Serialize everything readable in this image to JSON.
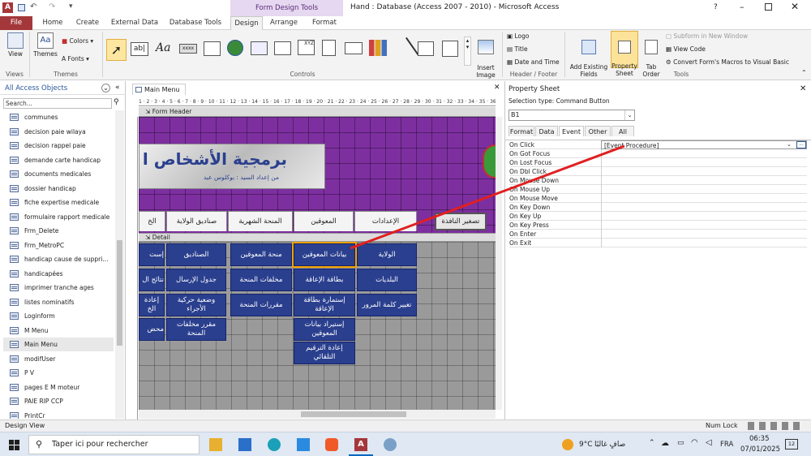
{
  "titlebar": {
    "title": "Hand : Database (Access 2007 - 2010) - Microsoft Access",
    "context_tab": "Form Design Tools"
  },
  "ribbon_tabs": [
    "File",
    "Home",
    "Create",
    "External Data",
    "Database Tools",
    "Design",
    "Arrange",
    "Format"
  ],
  "ribbon": {
    "views": {
      "view": "View",
      "group": "Views"
    },
    "themes": {
      "themes": "Themes",
      "colors": "Colors",
      "fonts": "Fonts",
      "group": "Themes"
    },
    "controls": {
      "group": "Controls",
      "insert_image": "Insert\nImage"
    },
    "header_footer": {
      "logo": "Logo",
      "title": "Title",
      "date_time": "Date and Time",
      "group": "Header / Footer"
    },
    "tools": {
      "add_fields": "Add Existing\nFields",
      "property_sheet": "Property\nSheet",
      "tab_order": "Tab\nOrder",
      "subform": "Subform in New Window",
      "view_code": "View Code",
      "convert": "Convert Form's Macros to Visual Basic",
      "group": "Tools"
    }
  },
  "nav": {
    "header": "All Access Objects",
    "search_placeholder": "Search...",
    "items": [
      "communes",
      "decision paie wilaya",
      "decision rappel paie",
      "demande carte handicap",
      "documents medicales",
      "dossier handicap",
      "fiche expertise medicale",
      "formulaire rapport medicale",
      "Frm_Delete",
      "Frm_MetroPC",
      "handicap cause de suppri...",
      "handicapées",
      "imprimer tranche ages",
      "listes nominatifs",
      "Loginform",
      "M Menu",
      "Main Menu",
      "modifUser",
      "P V",
      "pages E M moteur",
      "PAIE RIP CCP",
      "PrintCr"
    ],
    "selected": "Main Menu"
  },
  "doc": {
    "tab": "Main Menu",
    "form_header": "Form Header",
    "detail": "Detail",
    "banner_title": "برمجية الأشخاص ا",
    "banner_sub": "من إعداد السيد : بوكلوس عبد",
    "ruler": "1 · 2 · 3 · 4 · 5 · 6 · 7 · 8 · 9 · 10 · 11 · 12 · 13 · 14 · 15 · 16 · 17 · 18 · 19 · 20 · 21 · 22 · 23 · 24 · 25 · 26 · 27 · 28 · 29 · 30 · 31 · 32 · 33 · 34 · 35 · 36 · 37 · 38 · 39 · 40",
    "tabs": [
      "الإعدادات",
      "المعوقين",
      "المنحة الشهرية",
      "صناديق الولاية",
      "الخ"
    ],
    "close_button": "تصغير النافذة",
    "buttons_col1": [
      "الولاية",
      "البلديات",
      "تغيير كلمة المرور"
    ],
    "buttons_col2": [
      "بيانات المعوقين",
      "بطاقة الإعاقة",
      "إستمارة بطاقة الإعاقة",
      "إستيراد بيانات المعوقين",
      "إعادة الترقيم التلقائي"
    ],
    "buttons_col3": [
      "منحة المعوقين",
      "مخلفات المنحة",
      "مقررات المنحة"
    ],
    "buttons_col4": [
      "الصناديق",
      "جدول الإرسال",
      "وضعية حركية الأجراء",
      "مقرر مخلفات المنحة"
    ],
    "buttons_col5": [
      "إست",
      "نتائج ال",
      "إعادة الخ",
      "محض"
    ]
  },
  "property": {
    "title": "Property Sheet",
    "selection_type_label": "Selection type:",
    "selection_type": "Command Button",
    "selected_object": "B1",
    "tabs": [
      "Format",
      "Data",
      "Event",
      "Other",
      "All"
    ],
    "active_tab": "Event",
    "rows": [
      {
        "name": "On Click",
        "value": "[Event Procedure]"
      },
      {
        "name": "On Got Focus",
        "value": ""
      },
      {
        "name": "On Lost Focus",
        "value": ""
      },
      {
        "name": "On Dbl Click",
        "value": ""
      },
      {
        "name": "On Mouse Down",
        "value": ""
      },
      {
        "name": "On Mouse Up",
        "value": ""
      },
      {
        "name": "On Mouse Move",
        "value": ""
      },
      {
        "name": "On Key Down",
        "value": ""
      },
      {
        "name": "On Key Up",
        "value": ""
      },
      {
        "name": "On Key Press",
        "value": ""
      },
      {
        "name": "On Enter",
        "value": ""
      },
      {
        "name": "On Exit",
        "value": ""
      }
    ]
  },
  "status": {
    "left": "Design View",
    "numlock": "Num Lock"
  },
  "taskbar": {
    "search": "Taper ici pour rechercher",
    "temp": "9°C",
    "weather": "صافٍ غالبًا",
    "lang": "FRA",
    "time": "06:35",
    "date": "07/01/2025",
    "notif": "12"
  },
  "colors": {
    "form_header": "#7d2fa0",
    "button": "#2a3f8e",
    "arrow": "#e02020",
    "accent": "#a4373a"
  }
}
